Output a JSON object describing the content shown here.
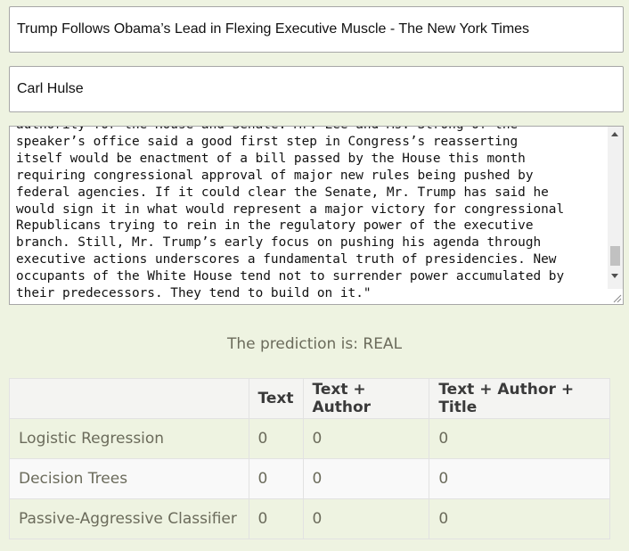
{
  "form": {
    "title_value": "Trump Follows Obama’s Lead in Flexing Executive Muscle - The New York Times",
    "author_value": "Carl Hulse",
    "text_value": "authority for the House and Senate. Mr. Lee and Ms. Strong of the\nspeaker’s office said a good first step in Congress’s reasserting\nitself would be enactment of a bill passed by the House this month\nrequiring congressional approval of major new rules being pushed by\nfederal agencies. If it could clear the Senate, Mr. Trump has said he\nwould sign it in what would represent a major victory for congressional\nRepublicans trying to rein in the regulatory power of the executive\nbranch. Still, Mr. Trump’s early focus on pushing his agenda through\nexecutive actions underscores a fundamental truth of presidencies. New\noccupants of the White House tend not to surrender power accumulated by\ntheir predecessors. They tend to build on it.\""
  },
  "prediction": "The prediction is: REAL",
  "results": {
    "headers": [
      "",
      "Text",
      "Text + Author",
      "Text + Author + Title"
    ],
    "rows": [
      {
        "model": "Logistic Regression",
        "values": [
          "0",
          "0",
          "0"
        ]
      },
      {
        "model": "Decision Trees",
        "values": [
          "0",
          "0",
          "0"
        ]
      },
      {
        "model": "Passive-Aggressive Classifier",
        "values": [
          "0",
          "0",
          "0"
        ]
      }
    ]
  }
}
